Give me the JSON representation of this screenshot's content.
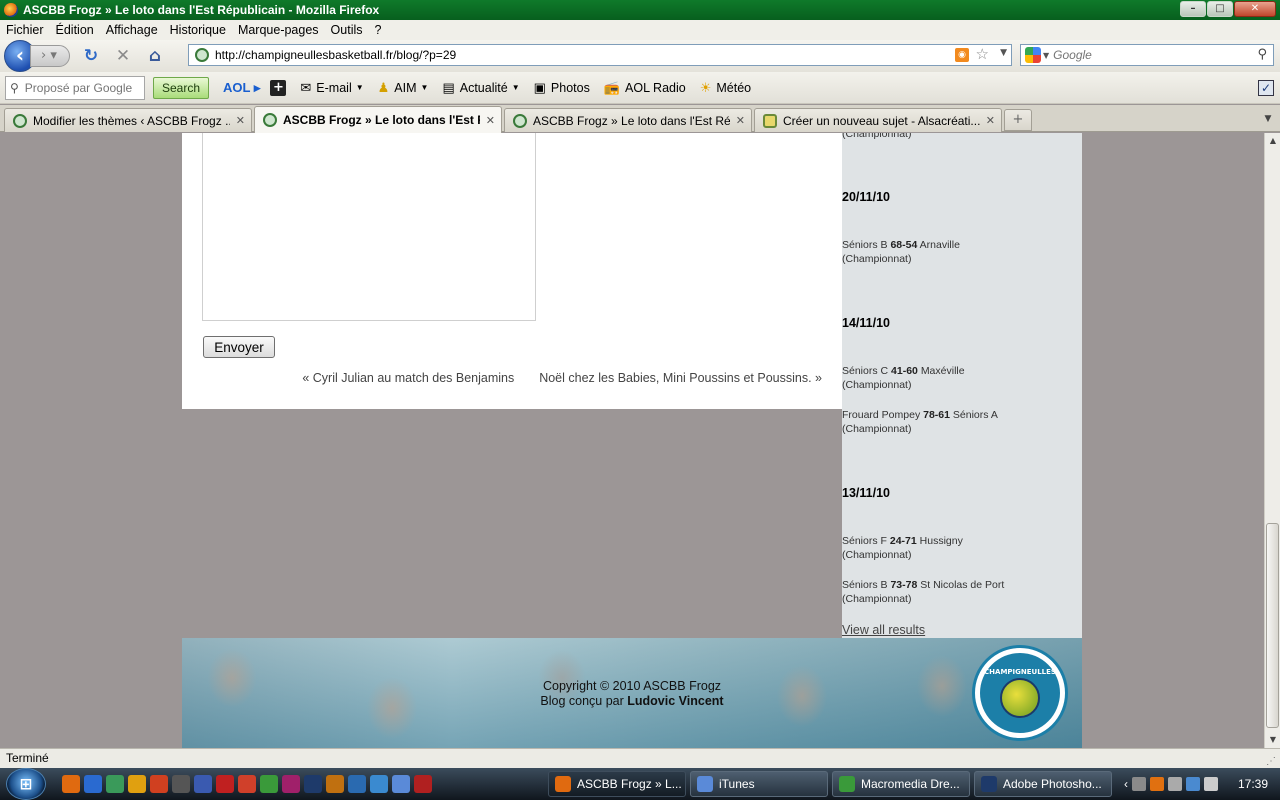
{
  "window": {
    "title": "ASCBB Frogz » Le loto dans l'Est Républicain - Mozilla Firefox",
    "buttons": {
      "minimize": "–",
      "maximize": "□",
      "close": "✕"
    }
  },
  "menu": [
    "Fichier",
    "Édition",
    "Affichage",
    "Historique",
    "Marque-pages",
    "Outils",
    "?"
  ],
  "nav": {
    "url": "http://champigneullesbasketball.fr/blog/?p=29",
    "search_placeholder": "Google"
  },
  "aol": {
    "search_placeholder": "Proposé par Google",
    "search_button": "Search",
    "logo": "AOL",
    "items": [
      "E-mail",
      "AIM",
      "Actualité",
      "Photos",
      "AOL Radio",
      "Météo"
    ]
  },
  "tabs": [
    {
      "label": "Modifier les thèmes ‹ ASCBB Frogz ...",
      "active": false
    },
    {
      "label": "ASCBB Frogz » Le loto dans l'Est R...",
      "active": true
    },
    {
      "label": "ASCBB Frogz » Le loto dans l'Est Ré...",
      "active": false
    },
    {
      "label": "Créer un nouveau sujet - Alsacréati...",
      "active": false
    }
  ],
  "page": {
    "send_button": "Envoyer",
    "prev_link": {
      "arrow": "«",
      "label": "Cyril Julian au match des Benjamins"
    },
    "next_link": {
      "arrow": "»",
      "label": "Noël chez les Babies, Mini Poussins et Poussins."
    }
  },
  "results": {
    "top_partial": "(Championnat)",
    "groups": [
      {
        "date": "20/11/10",
        "matches": [
          {
            "home": "Séniors B",
            "score": "68-54",
            "away": "Arnaville",
            "type": "(Championnat)"
          }
        ]
      },
      {
        "date": "14/11/10",
        "matches": [
          {
            "home": "Séniors C",
            "score": "41-60",
            "away": "Maxéville",
            "type": "(Championnat)"
          },
          {
            "home": "Frouard Pompey",
            "score": "78-61",
            "away": "Séniors A",
            "type": "(Championnat)"
          }
        ]
      },
      {
        "date": "13/11/10",
        "matches": [
          {
            "home": "Séniors F",
            "score": "24-71",
            "away": "Hussigny",
            "type": "(Championnat)"
          },
          {
            "home": "Séniors B",
            "score": "73-78",
            "away": "St Nicolas de Port",
            "type": "(Championnat)"
          }
        ]
      }
    ],
    "view_all": "View all results"
  },
  "footer": {
    "copyright": "Copyright © 2010 ASCBB Frogz",
    "credit_prefix": "Blog conçu par",
    "credit_name": "Ludovic Vincent",
    "logo_text": "CHAMPIGNEULLES"
  },
  "status": "Terminé",
  "taskbar": {
    "tasks": [
      {
        "label": "ASCBB Frogz » L...",
        "active": true,
        "color": "#e06a10"
      },
      {
        "label": "iTunes",
        "active": false,
        "color": "#5a8ad8"
      },
      {
        "label": "Macromedia Dre...",
        "active": false,
        "color": "#3a9a3a"
      },
      {
        "label": "Adobe Photosho...",
        "active": false,
        "color": "#1e3a6a"
      }
    ],
    "clock": "17:39"
  },
  "colors": {
    "page_bg": "#9c9696",
    "sidebar_bg": "#dfe3e5",
    "title_bar": "#0f7a2a"
  }
}
